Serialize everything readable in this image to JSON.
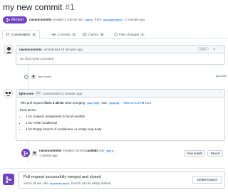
{
  "header": {
    "title": "my new commit",
    "number": "#1"
  },
  "meta": {
    "status": "Merged",
    "author": "navancommits",
    "text_merged": "merged 1 commit into",
    "base_branch": "main",
    "text_from": "from",
    "head_branch": "mynewbranch",
    "time": "2 minutes ago"
  },
  "tabs": [
    {
      "label": "Conversation",
      "count": "0"
    },
    {
      "label": "Commits",
      "count": "1"
    },
    {
      "label": "Checks",
      "count": "0"
    },
    {
      "label": "Files changed",
      "count": "1"
    }
  ],
  "comment1": {
    "author": "navancommits",
    "action": "commented 18 minutes ago",
    "owner_label": "Owner",
    "body": "No description provided."
  },
  "commit_row": {
    "message": "new commit",
    "verified": "9a4c9be"
  },
  "bot_comment": {
    "author": "lgtm-com",
    "bot_label": "bot",
    "action": "commented 11 minutes ago",
    "line1_prefix": "This pull request",
    "line1_bold": "fixes 3 alerts",
    "line1_mid": "when merging",
    "line1_hash": "9ae7960",
    "line1_into": "into",
    "line1_base": "4ed8d0",
    "line1_link": "- view on LGTM.com",
    "fixed_label": "fixed alerts:",
    "alerts": [
      "1 for Useless assignment to local variable",
      "1 for Futile conditional",
      "1 for Empty branch of conditional, or empty loop body"
    ]
  },
  "merge_event": {
    "author": "navancommits",
    "text": "merged commit",
    "commit": "ca4da6c",
    "into": "into",
    "branch": "main",
    "time": "1 minute ago",
    "view_details": "View details",
    "revert": "Revert"
  },
  "merge_panel": {
    "title": "Pull request successfully merged and closed",
    "sub_prefix": "You're all set—the",
    "branch": "mynewbranch",
    "sub_suffix": "branch can be safely deleted.",
    "delete_button": "Delete branch"
  },
  "colors": {
    "merged": "#6f42c1",
    "link": "#0366d6",
    "border": "#d1d5da"
  }
}
